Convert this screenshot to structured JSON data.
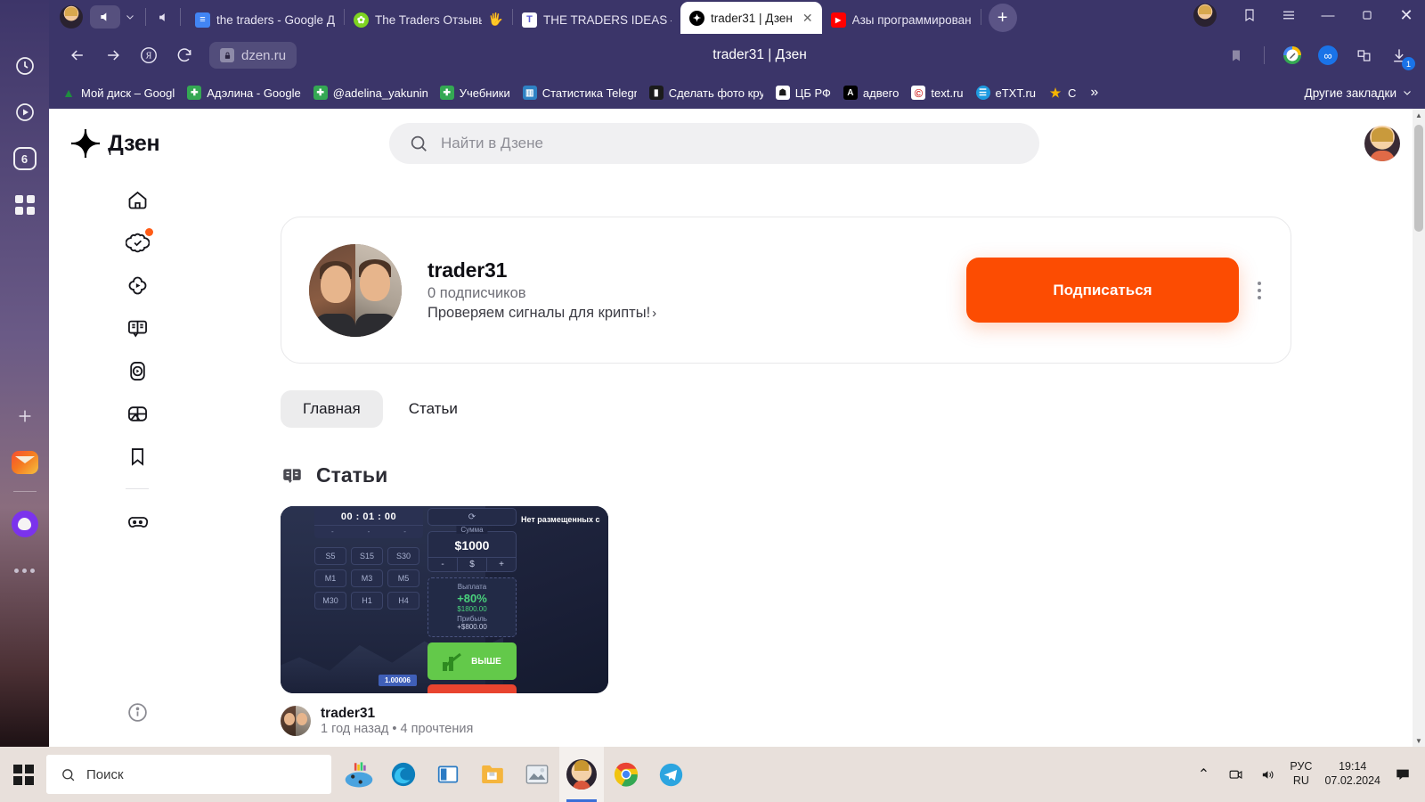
{
  "browser": {
    "tabs": [
      {
        "title": "the traders - Google Д",
        "favicon": "docs-icon",
        "color": "#4285f4",
        "glyph": "≡",
        "active": false
      },
      {
        "title": "The Traders Отзывы",
        "favicon": "green-flower-icon",
        "color": "#7ed321",
        "glyph": "✿",
        "active": false
      },
      {
        "title": "THE TRADERS IDEAS –",
        "favicon": "t-letter-icon",
        "color": "#ffffff",
        "glyph": "T",
        "active": false
      },
      {
        "title": "trader31 | Дзен",
        "favicon": "dzen-icon",
        "color": "#000000",
        "glyph": "✦",
        "active": true
      },
      {
        "title": "Азы программирован",
        "favicon": "youtube-icon",
        "color": "#ff0000",
        "glyph": "▶",
        "active": false
      }
    ],
    "new_tab_label": "+",
    "window_controls": {
      "minimize": "—",
      "maximize": "❐",
      "close": "✕"
    },
    "omnibox_url": "dzen.ru",
    "page_title": "trader31 | Дзен",
    "bookmarks": [
      {
        "label": "Мой диск – Googl",
        "glyph": "▲",
        "color": "#ffffff",
        "text_color": "#1e8e3e"
      },
      {
        "label": "Адэлина - Google",
        "glyph": "✚",
        "color": "#34a853",
        "text_color": "#ffffff"
      },
      {
        "label": "@adelina_yakunina",
        "glyph": "✚",
        "color": "#34a853",
        "text_color": "#ffffff"
      },
      {
        "label": "Учебники",
        "glyph": "✚",
        "color": "#34a853",
        "text_color": "#ffffff"
      },
      {
        "label": "Статистика Telegra",
        "glyph": "▥",
        "color": "#2f82c4",
        "text_color": "#ffffff"
      },
      {
        "label": "Сделать фото кру",
        "glyph": "▮",
        "color": "#1b1b1b",
        "text_color": "#ffffff"
      },
      {
        "label": "ЦБ РФ",
        "glyph": "☗",
        "color": "#ffffff",
        "text_color": "#1b1b1b"
      },
      {
        "label": "адвего",
        "glyph": "A",
        "color": "#000000",
        "text_color": "#ffffff"
      },
      {
        "label": "text.ru",
        "glyph": "©",
        "color": "#ffffff",
        "text_color": "#d32f2f"
      },
      {
        "label": "eTXT.ru",
        "glyph": "☰",
        "color": "#1e9ae0",
        "text_color": "#ffffff"
      },
      {
        "label": "С",
        "glyph": "★",
        "color": "#ffffff",
        "text_color": "#f5b400"
      }
    ],
    "bookmarks_overflow": "»",
    "other_bookmarks": "Другие закладки",
    "download_badge": "1"
  },
  "yandex_sidebar": {
    "badge_count": "6",
    "items": [
      "clock-icon",
      "play-circle-icon",
      "counter-badge",
      "apps-grid-icon",
      "plus-icon",
      "mail-icon",
      "alice-icon",
      "more-dots-icon"
    ]
  },
  "dzen": {
    "logo_text": "Дзен",
    "search_placeholder": "Найти в Дзене",
    "nav_items": [
      {
        "name": "home-icon",
        "badge": false
      },
      {
        "name": "recommendations-icon",
        "badge": true
      },
      {
        "name": "video-icon",
        "badge": false
      },
      {
        "name": "articles-icon",
        "badge": false
      },
      {
        "name": "shorts-icon",
        "badge": false
      },
      {
        "name": "live-icon",
        "badge": false
      },
      {
        "name": "bookmarks-icon",
        "badge": false
      },
      {
        "name": "games-icon",
        "badge": false
      }
    ],
    "profile": {
      "name": "trader31",
      "subscribers": "0 подписчиков",
      "description": "Проверяем сигналы для крипты!",
      "description_chevron": "›",
      "subscribe_button": "Подписаться"
    },
    "tabs": [
      {
        "label": "Главная",
        "active": true
      },
      {
        "label": "Статьи",
        "active": false
      }
    ],
    "section": {
      "title": "Статьи",
      "icon": "book-icon"
    },
    "article": {
      "author": "trader31",
      "meta": "1 год назад • 4 прочтения",
      "thumbnail": {
        "timer": "00 : 01 : 00",
        "timer_subs": [
          "-",
          "-",
          "-"
        ],
        "timeframes": [
          "S5",
          "S15",
          "S30",
          "M1",
          "M3",
          "M5",
          "M30",
          "H1",
          "H4"
        ],
        "price_tag": "1.00006",
        "amount_label": "Сумма",
        "amount_value": "$1000",
        "amount_controls": [
          "-",
          "$",
          "+"
        ],
        "payout_label": "Выплата",
        "payout_percent": "+80%",
        "payout_amount": "$1800.00",
        "profit_label": "Прибыль",
        "profit_amount": "+$800.00",
        "up_button": "ВЫШЕ",
        "right_text": "Нет размещенных с"
      }
    }
  },
  "taskbar": {
    "search_placeholder": "Поиск",
    "apps": [
      {
        "name": "gallery-app",
        "glyph": "🎨"
      },
      {
        "name": "edge-browser",
        "glyph": "◉"
      },
      {
        "name": "explorer-window",
        "glyph": "▤"
      },
      {
        "name": "file-explorer",
        "glyph": "🗂"
      },
      {
        "name": "photos-app",
        "glyph": "🖼"
      },
      {
        "name": "yandex-browser",
        "glyph": "Я",
        "active": true
      },
      {
        "name": "chrome-browser",
        "glyph": "◎"
      },
      {
        "name": "telegram-app",
        "glyph": "➤"
      }
    ],
    "tray": {
      "lang_line1": "РУС",
      "lang_line2": "RU",
      "time": "19:14",
      "date": "07.02.2024",
      "chevron": "⌃"
    }
  }
}
